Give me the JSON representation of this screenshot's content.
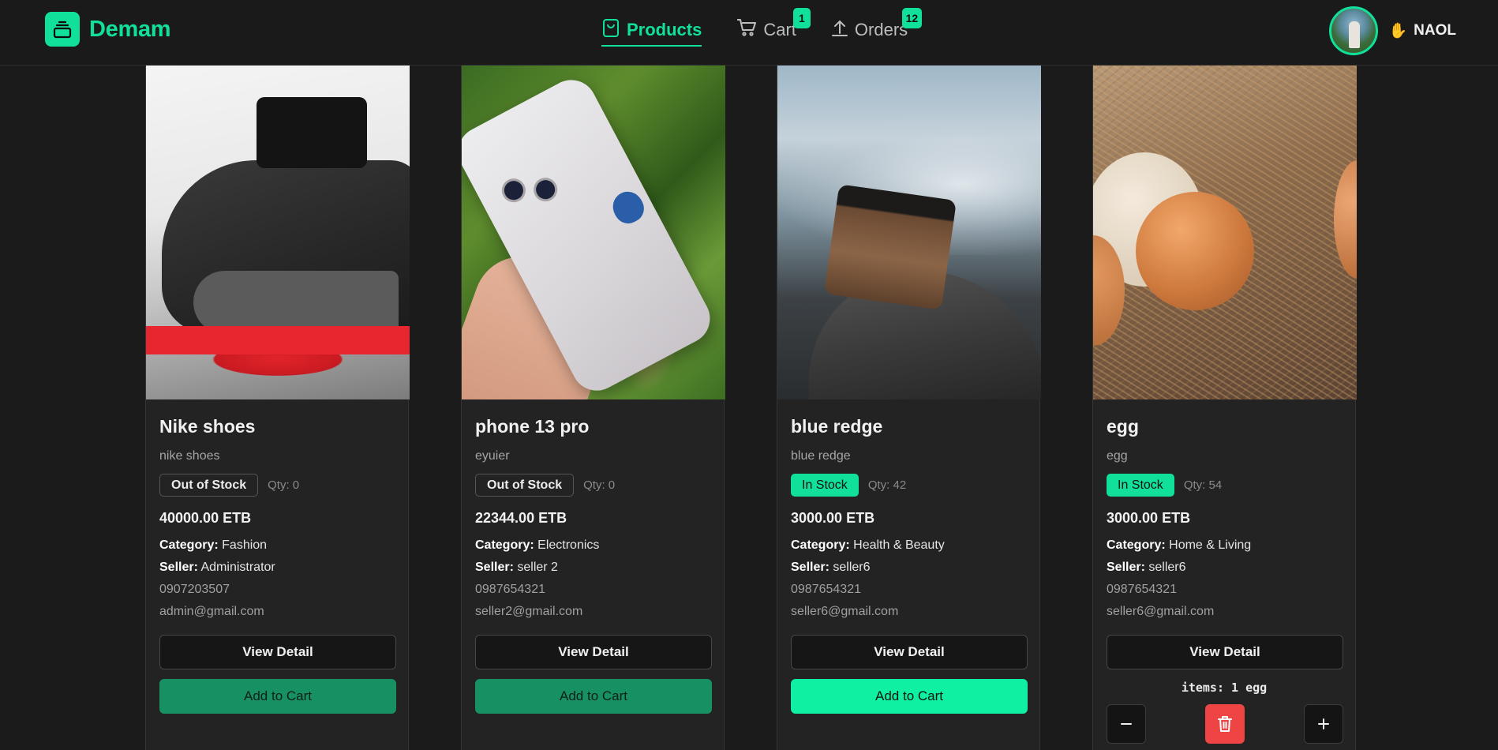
{
  "brand": {
    "name": "Demam",
    "logo_icon": "stack-icon",
    "accent": "#10e09a"
  },
  "nav": {
    "products": {
      "label": "Products",
      "icon": "shopping-bag-icon"
    },
    "cart": {
      "label": "Cart",
      "icon": "cart-icon",
      "badge": "1"
    },
    "orders": {
      "label": "Orders",
      "icon": "upload-icon",
      "badge": "12"
    }
  },
  "user": {
    "greeting_icon": "waving-hand",
    "name": "NAOL"
  },
  "products": [
    {
      "name": "Nike shoes",
      "description": "nike shoes",
      "stock": "Out of Stock",
      "qty": "Qty: 0",
      "price": "40000.00 ETB",
      "category_label": "Category:",
      "category": "Fashion",
      "seller_label": "Seller:",
      "seller": "Administrator",
      "phone": "0907203507",
      "email": "admin@gmail.com",
      "detail_label": "View Detail",
      "cart_label": "Add to Cart"
    },
    {
      "name": "phone 13 pro",
      "description": "eyuier",
      "stock": "Out of Stock",
      "qty": "Qty: 0",
      "price": "22344.00 ETB",
      "category_label": "Category:",
      "category": "Electronics",
      "seller_label": "Seller:",
      "seller": "seller 2",
      "phone": "0987654321",
      "email": "seller2@gmail.com",
      "detail_label": "View Detail",
      "cart_label": "Add to Cart"
    },
    {
      "name": "blue redge",
      "description": "blue redge",
      "stock": "In Stock",
      "qty": "Qty: 42",
      "price": "3000.00 ETB",
      "category_label": "Category:",
      "category": "Health & Beauty",
      "seller_label": "Seller:",
      "seller": "seller6",
      "phone": "0987654321",
      "email": "seller6@gmail.com",
      "detail_label": "View Detail",
      "cart_label": "Add to Cart"
    },
    {
      "name": "egg",
      "description": "egg",
      "stock": "In Stock",
      "qty": "Qty: 54",
      "price": "3000.00 ETB",
      "category_label": "Category:",
      "category": "Home & Living",
      "seller_label": "Seller:",
      "seller": "seller6",
      "phone": "0987654321",
      "email": "seller6@gmail.com",
      "detail_label": "View Detail",
      "cart_items": "items: 1 egg"
    }
  ],
  "colors": {
    "in_stock": "#10e09a",
    "delete": "#ef4444",
    "disabled_cart": "#179163"
  }
}
